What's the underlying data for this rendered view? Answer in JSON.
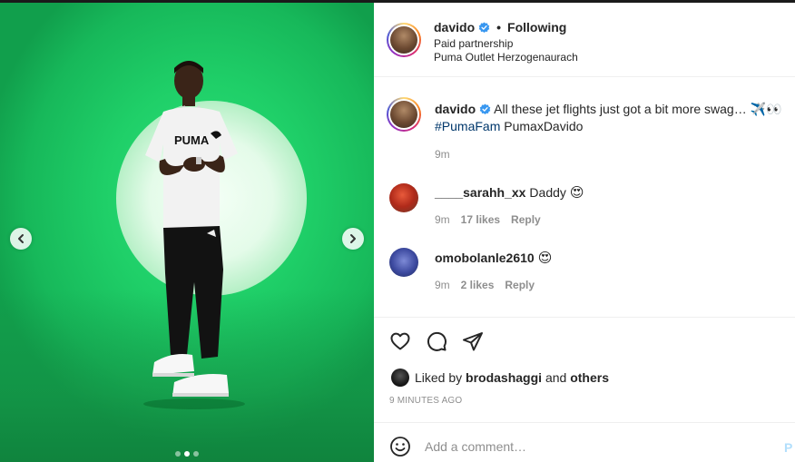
{
  "post": {
    "username": "davido",
    "follow_status": "Following",
    "separator": "•",
    "subtitle_1": "Paid partnership",
    "subtitle_2": "Puma Outlet Herzogenaurach",
    "media": {
      "slide_count": 3,
      "active_slide": 2
    }
  },
  "caption": {
    "username": "davido",
    "text": "All these jet flights just got a bit more swag… ✈️👀",
    "hashtag": "#PumaFam",
    "after_tag": "PumaxDavido",
    "time": "9m"
  },
  "comments": [
    {
      "username": "____sarahh_xx",
      "text": "Daddy",
      "emoji": "😍",
      "time": "9m",
      "likes": "17 likes",
      "reply": "Reply"
    },
    {
      "username": "omobolanle2610",
      "text": "",
      "emoji": "😍",
      "time": "9m",
      "likes": "2 likes",
      "reply": "Reply"
    }
  ],
  "likes": {
    "prefix": "Liked by",
    "user": "brodashaggi",
    "conj": "and",
    "others": "others"
  },
  "timestamp": "9 MINUTES AGO",
  "composer": {
    "placeholder": "Add a comment…",
    "post_label": "P"
  },
  "icons": {
    "verified": "verified-badge-icon",
    "like": "heart-icon",
    "comment": "speech-bubble-icon",
    "share": "paper-plane-icon",
    "emoji": "smiley-icon",
    "prev": "chevron-left-icon",
    "next": "chevron-right-icon"
  },
  "colors": {
    "verified": "#3897f0",
    "hashtag": "#00376b",
    "secondary_text": "#8e8e8e",
    "post_button": "#b2dffc",
    "backdrop_green": "#1fcf68"
  }
}
